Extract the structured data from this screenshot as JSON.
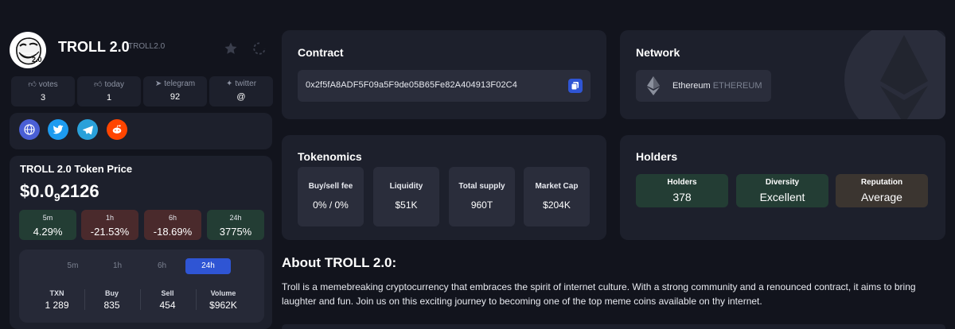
{
  "token": {
    "name": "TROLL 2.0",
    "symbol": "TROLL2.0",
    "avatar_text": "2.0"
  },
  "stats": [
    {
      "label": "votes",
      "value": "3",
      "icon": "thumbs-up-icon"
    },
    {
      "label": "today",
      "value": "1",
      "icon": "thumbs-up-icon"
    },
    {
      "label": "telegram",
      "value": "92",
      "icon": "telegram-icon"
    },
    {
      "label": "twitter",
      "value": "@",
      "icon": "twitter-icon"
    }
  ],
  "price": {
    "title": "TROLL 2.0 Token Price",
    "prefix": "$0.0",
    "sub": "9",
    "suffix": "2126"
  },
  "changes": [
    {
      "period": "5m",
      "value": "4.29%",
      "trend": "up"
    },
    {
      "period": "1h",
      "value": "-21.53%",
      "trend": "down"
    },
    {
      "period": "6h",
      "value": "-18.69%",
      "trend": "down"
    },
    {
      "period": "24h",
      "value": "3775%",
      "trend": "up"
    }
  ],
  "tabs": [
    {
      "label": "5m",
      "active": false
    },
    {
      "label": "1h",
      "active": false
    },
    {
      "label": "6h",
      "active": false
    },
    {
      "label": "24h",
      "active": true
    }
  ],
  "txn": [
    {
      "label": "TXN",
      "value": "1 289"
    },
    {
      "label": "Buy",
      "value": "835"
    },
    {
      "label": "Sell",
      "value": "454"
    },
    {
      "label": "Volume",
      "value": "$962K"
    }
  ],
  "contract": {
    "title": "Contract",
    "address": "0x2f5fA8ADF5F09a5F9de05B65Fe82A404913F02C4"
  },
  "network": {
    "title": "Network",
    "name": "Ethereum",
    "code": "ETHEREUM"
  },
  "tokenomics": {
    "title": "Tokenomics",
    "items": [
      {
        "label": "Buy/sell fee",
        "value": "0% / 0%"
      },
      {
        "label": "Liquidity",
        "value": "$51K"
      },
      {
        "label": "Total supply",
        "value": "960T"
      },
      {
        "label": "Market Cap",
        "value": "$204K"
      }
    ]
  },
  "holders": {
    "title": "Holders",
    "items": [
      {
        "label": "Holders",
        "value": "378",
        "color": "#233d34"
      },
      {
        "label": "Diversity",
        "value": "Excellent",
        "color": "#233d34"
      },
      {
        "label": "Reputation",
        "value": "Average",
        "color": "#3b3530"
      }
    ]
  },
  "about": {
    "title": "About TROLL 2.0:",
    "text": "Troll is a memebreaking cryptocurrency that embraces the spirit of internet culture. With a strong community and a renounced contract, it aims to bring laughter and fun. Join us on this exciting journey to becoming one of the top meme coins available on thy internet."
  },
  "colors": {
    "accent": "#2f55d4",
    "up": "#233d34",
    "down": "#4a2a2c",
    "card": "#1d202c"
  }
}
